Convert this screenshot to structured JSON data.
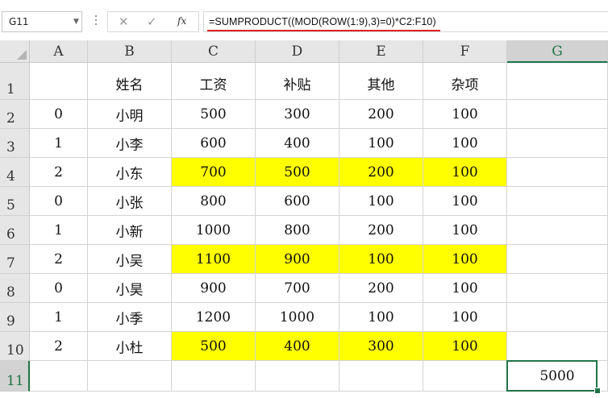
{
  "name_box": {
    "value": "G11"
  },
  "formula_bar": {
    "cancel_icon": "✕",
    "enter_icon": "✓",
    "fx_label": "fx",
    "formula": "=SUMPRODUCT((MOD(ROW(1:9),3)=0)*C2:F10)"
  },
  "colors": {
    "highlight": "#ffff00",
    "selection": "#217346",
    "underline": "#e02020"
  },
  "columns": [
    "A",
    "B",
    "C",
    "D",
    "E",
    "F",
    "G"
  ],
  "rows": [
    {
      "num": "1",
      "cells": [
        "",
        "姓名",
        "工资",
        "补贴",
        "其他",
        "杂项",
        ""
      ],
      "highlight": false
    },
    {
      "num": "2",
      "cells": [
        "0",
        "小明",
        "500",
        "300",
        "200",
        "100",
        ""
      ],
      "highlight": false
    },
    {
      "num": "3",
      "cells": [
        "1",
        "小李",
        "600",
        "400",
        "100",
        "100",
        ""
      ],
      "highlight": false
    },
    {
      "num": "4",
      "cells": [
        "2",
        "小东",
        "700",
        "500",
        "200",
        "100",
        ""
      ],
      "highlight": true
    },
    {
      "num": "5",
      "cells": [
        "0",
        "小张",
        "800",
        "600",
        "100",
        "100",
        ""
      ],
      "highlight": false
    },
    {
      "num": "6",
      "cells": [
        "1",
        "小新",
        "1000",
        "800",
        "200",
        "100",
        ""
      ],
      "highlight": false
    },
    {
      "num": "7",
      "cells": [
        "2",
        "小吴",
        "1100",
        "900",
        "100",
        "100",
        ""
      ],
      "highlight": true
    },
    {
      "num": "8",
      "cells": [
        "0",
        "小昊",
        "900",
        "700",
        "200",
        "100",
        ""
      ],
      "highlight": false
    },
    {
      "num": "9",
      "cells": [
        "1",
        "小季",
        "1200",
        "1000",
        "100",
        "100",
        ""
      ],
      "highlight": false
    },
    {
      "num": "10",
      "cells": [
        "2",
        "小杜",
        "500",
        "400",
        "300",
        "100",
        ""
      ],
      "highlight": true
    },
    {
      "num": "11",
      "cells": [
        "",
        "",
        "",
        "",
        "",
        "",
        "5000"
      ],
      "highlight": false
    }
  ],
  "active_cell": {
    "col": 6,
    "row": 10
  }
}
